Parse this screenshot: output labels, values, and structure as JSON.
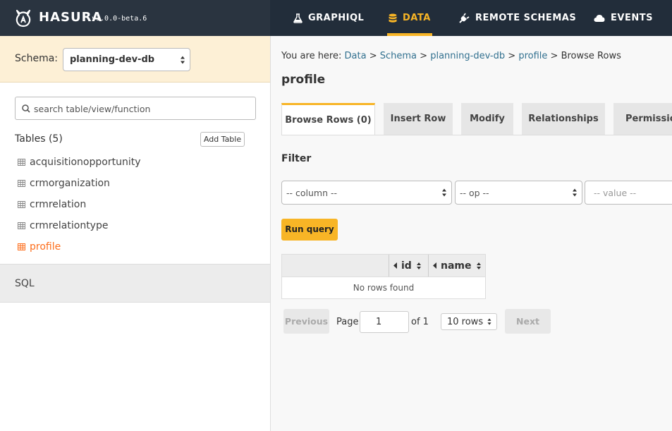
{
  "header": {
    "brand_name": "HASURA",
    "version": "v1.0.0-beta.6",
    "nav": [
      {
        "label": "GRAPHIQL",
        "icon": "flask-icon"
      },
      {
        "label": "DATA",
        "icon": "database-icon",
        "active": true
      },
      {
        "label": "REMOTE SCHEMAS",
        "icon": "plug-icon"
      },
      {
        "label": "EVENTS",
        "icon": "cloud-icon"
      }
    ],
    "accent_color": "#f8b526"
  },
  "sidebar": {
    "schema_label": "Schema:",
    "schema_value": "planning-dev-db",
    "search_placeholder": "search table/view/function",
    "tables_label": "Tables (5)",
    "add_table_label": "Add Table",
    "tables": [
      {
        "name": "acquisitionopportunity"
      },
      {
        "name": "crmorganization"
      },
      {
        "name": "crmrelation"
      },
      {
        "name": "crmrelationtype"
      },
      {
        "name": "profile",
        "active": true
      }
    ],
    "sql_label": "SQL",
    "active_color": "#fd6e1c"
  },
  "main": {
    "breadcrumb": {
      "prefix": "You are here:",
      "items": [
        "Data",
        "Schema",
        "planning-dev-db",
        "profile"
      ],
      "current": "Browse Rows",
      "separator": ">"
    },
    "title": "profile",
    "tabs": [
      {
        "label": "Browse Rows (0)",
        "active": true
      },
      {
        "label": "Insert Row"
      },
      {
        "label": "Modify"
      },
      {
        "label": "Relationships"
      },
      {
        "label": "Permissions"
      }
    ],
    "filter": {
      "label": "Filter",
      "column_value": "-- column --",
      "op_value": "-- op --",
      "value_placeholder": "-- value --",
      "run_label": "Run query"
    },
    "grid": {
      "columns": [
        "id",
        "name"
      ],
      "empty_text": "No rows found"
    },
    "pagination": {
      "previous_label": "Previous",
      "page_label": "Page",
      "page_value": "1",
      "of_label": "of 1",
      "rows_value": "10 rows",
      "next_label": "Next"
    }
  }
}
